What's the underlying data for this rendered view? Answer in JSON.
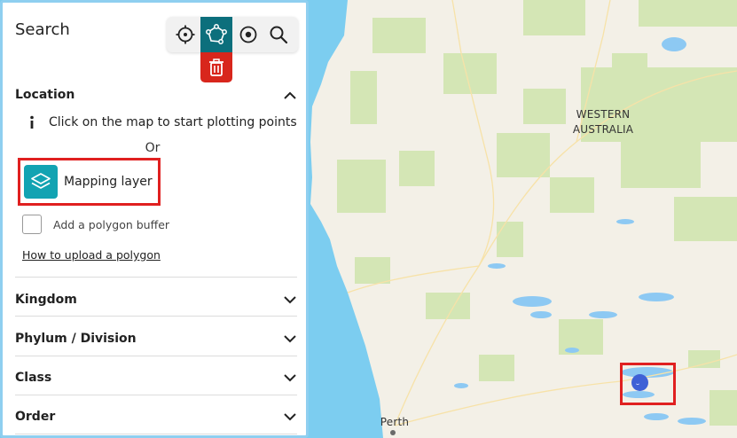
{
  "sidebar": {
    "title": "Search",
    "tools": {
      "crosshair": "crosshair-icon",
      "polygon": "polygon-draw-icon",
      "point": "target-point-icon",
      "search": "search-icon",
      "delete": "trash-icon"
    },
    "location": {
      "heading": "Location",
      "info_text": "Click on the map to start plotting points",
      "or_text": "Or",
      "mapping_layer_label": "Mapping layer",
      "buffer_label": "Add a polygon buffer",
      "buffer_checked": false,
      "upload_link": "How to upload a polygon"
    },
    "sections": [
      {
        "label": "Kingdom"
      },
      {
        "label": "Phylum / Division"
      },
      {
        "label": "Class"
      },
      {
        "label": "Order"
      }
    ]
  },
  "map": {
    "region_label_line1": "WESTERN",
    "region_label_line2": "AUSTRALIA",
    "city_label": "Perth"
  },
  "colors": {
    "active_tool": "#0c6f7c",
    "delete_button": "#d8261c",
    "mapping_layer_icon": "#12a3b2",
    "highlight_box": "#e02020",
    "plot_point": "#3f61d6",
    "sidebar_border": "#8fcff0",
    "ocean": "#7ccdf0",
    "land": "#f2efe6",
    "park": "#d4e6b5"
  }
}
